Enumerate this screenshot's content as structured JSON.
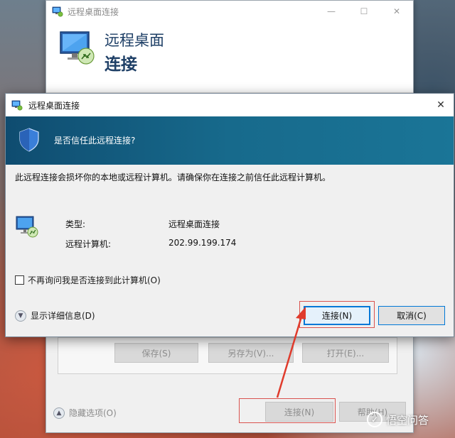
{
  "back_window": {
    "title": "远程桌面连接",
    "header_line1": "远程桌面",
    "header_line2": "连接",
    "caption_minimize": "—",
    "caption_maximize": "☐",
    "caption_close": "✕",
    "save_label": "保存(S)",
    "save_as_label": "另存为(V)...",
    "open_label": "打开(E)...",
    "hide_options_label": "隐藏选项(O)",
    "connect_label": "连接(N)",
    "help_label": "帮助(H)"
  },
  "dialog": {
    "title": "远程桌面连接",
    "close_glyph": "✕",
    "banner_question": "是否信任此远程连接?",
    "warning_text": "此远程连接会损坏你的本地或远程计算机。请确保你在连接之前信任此远程计算机。",
    "type_label": "类型:",
    "type_value": "远程桌面连接",
    "remote_label": "远程计算机:",
    "remote_value": "202.99.199.174",
    "dont_ask_label": "不再询问我是否连接到此计算机(O)",
    "dont_ask_checked": false,
    "show_details_label": "显示详细信息(D)",
    "connect_label": "连接(N)",
    "cancel_label": "取消(C)"
  },
  "watermark": {
    "logo_glyph": "✓",
    "text": "悟空问答"
  },
  "colors": {
    "banner": "#176a8c",
    "accent": "#0078d7",
    "highlight": "#d9534f",
    "arrow": "#e03b2c"
  },
  "icons": [
    "remote-desktop-icon",
    "shield-icon",
    "chevron-down-icon",
    "chevron-up-icon",
    "close-icon"
  ]
}
